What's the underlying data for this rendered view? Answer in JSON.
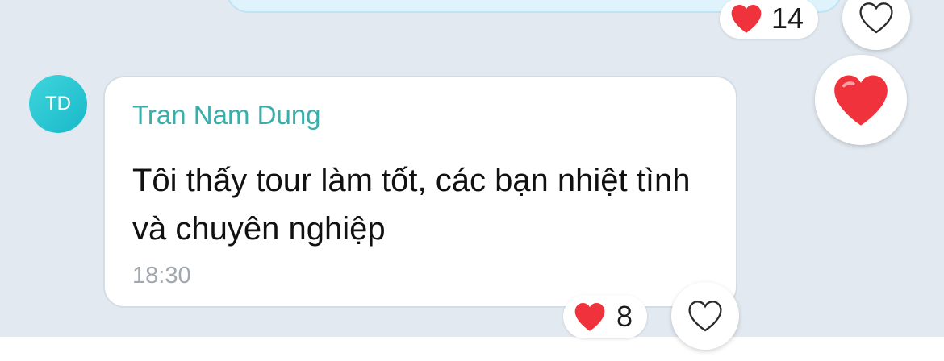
{
  "previous_message": {
    "reaction_count": "14"
  },
  "message": {
    "avatar_initials": "TD",
    "sender": "Tran Nam Dung",
    "text": "Tôi thấy tour làm tốt, các bạn nhiệt tình và chuyên nghiệp",
    "time": "18:30",
    "reaction_count": "8"
  },
  "colors": {
    "heart": "#f0323c",
    "sender_name": "#3aaeaa",
    "avatar": "#25c3d1",
    "chat_background": "#e2e9f1"
  },
  "icons": [
    "heart-icon",
    "heart-outline-icon",
    "heart-reaction-icon"
  ]
}
